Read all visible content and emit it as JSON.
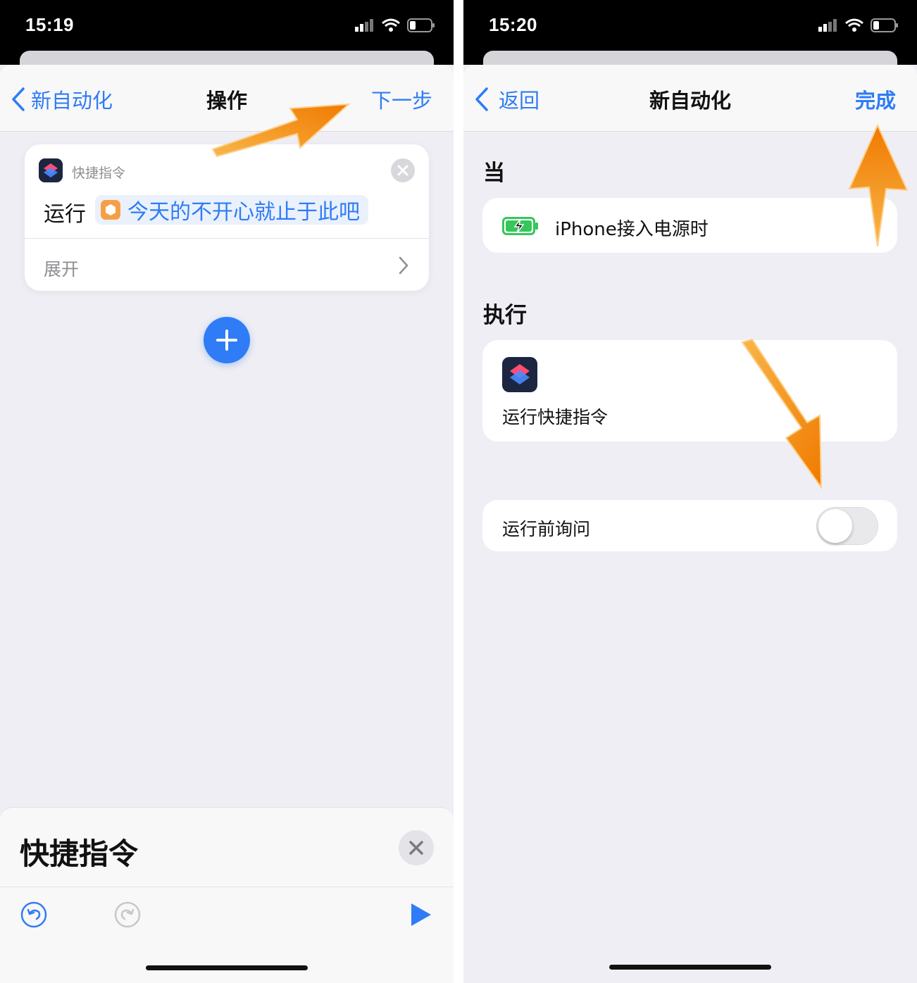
{
  "left": {
    "status": {
      "time": "15:19"
    },
    "nav": {
      "back": "新自动化",
      "title": "操作",
      "next": "下一步"
    },
    "action_card": {
      "app_name": "快捷指令",
      "run_label": "运行",
      "shortcut_name": "今天的不开心就止于此吧",
      "expand": "展开"
    },
    "bottom_sheet": {
      "title": "快捷指令"
    }
  },
  "right": {
    "status": {
      "time": "15:20"
    },
    "nav": {
      "back": "返回",
      "title": "新自动化",
      "done": "完成"
    },
    "when": {
      "header": "当",
      "trigger": "iPhone接入电源时"
    },
    "do": {
      "header": "执行",
      "action": "运行快捷指令"
    },
    "ask": {
      "label": "运行前询问",
      "enabled": false
    }
  },
  "colors": {
    "accent": "#2f7cf6",
    "annotation_arrow": "#f7900e",
    "background": "#efeef4"
  }
}
